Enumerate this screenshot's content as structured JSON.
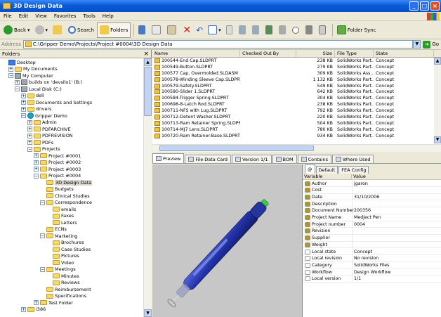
{
  "window": {
    "title": "3D Design Data"
  },
  "menu": [
    "File",
    "Edit",
    "View",
    "Favorites",
    "Tools",
    "Help"
  ],
  "toolbar": {
    "back": "Back",
    "search": "Search",
    "folders": "Folders",
    "folder_sync": "Folder Sync"
  },
  "address": {
    "label": "Address",
    "value": "C:\\Gripper Demo\\Projects\\Project #0004\\3D Design Data",
    "go": "Go"
  },
  "folders_pane": {
    "title": "Folders",
    "close": "×"
  },
  "tree": [
    {
      "label": "Desktop",
      "level": 0,
      "expander": "",
      "icon": "blue"
    },
    {
      "label": "My Documents",
      "level": 1,
      "expander": "+",
      "icon": "folder"
    },
    {
      "label": "My Computer",
      "level": 1,
      "expander": "−",
      "icon": "gray"
    },
    {
      "label": "builds on 'devsilo1' (B:)",
      "level": 2,
      "expander": "+",
      "icon": "gray"
    },
    {
      "label": "Local Disk (C:)",
      "level": 2,
      "expander": "−",
      "icon": "gray"
    },
    {
      "label": "dell",
      "level": 3,
      "expander": "+",
      "icon": "folder"
    },
    {
      "label": "Documents and Settings",
      "level": 3,
      "expander": "+",
      "icon": "folder"
    },
    {
      "label": "drivers",
      "level": 3,
      "expander": "+",
      "icon": "folder"
    },
    {
      "label": "Gripper Demo",
      "level": 3,
      "expander": "−",
      "icon": "vault"
    },
    {
      "label": "Admin",
      "level": 4,
      "expander": "+",
      "icon": "folder"
    },
    {
      "label": "PDFARCHIVE",
      "level": 4,
      "expander": "+",
      "icon": "folder"
    },
    {
      "label": "PDFREVISION",
      "level": 4,
      "expander": "+",
      "icon": "folder"
    },
    {
      "label": "PDFs",
      "level": 4,
      "expander": "+",
      "icon": "folder"
    },
    {
      "label": "Projects",
      "level": 4,
      "expander": "−",
      "icon": "folder"
    },
    {
      "label": "Project #0001",
      "level": 5,
      "expander": "+",
      "icon": "folder"
    },
    {
      "label": "Project #0002",
      "level": 5,
      "expander": "+",
      "icon": "folder"
    },
    {
      "label": "Project #0003",
      "level": 5,
      "expander": "+",
      "icon": "folder"
    },
    {
      "label": "Project #0004",
      "level": 5,
      "expander": "−",
      "icon": "folder"
    },
    {
      "label": "3D Design Data",
      "level": 6,
      "expander": "",
      "icon": "folder",
      "selected": true
    },
    {
      "label": "Budgets",
      "level": 6,
      "expander": "",
      "icon": "folder"
    },
    {
      "label": "Clinical Studies",
      "level": 6,
      "expander": "",
      "icon": "folder"
    },
    {
      "label": "Correspondence",
      "level": 6,
      "expander": "−",
      "icon": "folder"
    },
    {
      "label": "emails",
      "level": 7,
      "expander": "",
      "icon": "folder"
    },
    {
      "label": "Faxes",
      "level": 7,
      "expander": "",
      "icon": "folder"
    },
    {
      "label": "Letters",
      "level": 7,
      "expander": "",
      "icon": "folder"
    },
    {
      "label": "ECNs",
      "level": 6,
      "expander": "",
      "icon": "folder"
    },
    {
      "label": "Marketing",
      "level": 6,
      "expander": "−",
      "icon": "folder"
    },
    {
      "label": "Brochures",
      "level": 7,
      "expander": "",
      "icon": "folder"
    },
    {
      "label": "Case Studies",
      "level": 7,
      "expander": "",
      "icon": "folder"
    },
    {
      "label": "Pictures",
      "level": 7,
      "expander": "",
      "icon": "folder"
    },
    {
      "label": "Video",
      "level": 7,
      "expander": "",
      "icon": "folder"
    },
    {
      "label": "Meetings",
      "level": 6,
      "expander": "−",
      "icon": "folder"
    },
    {
      "label": "Minutes",
      "level": 7,
      "expander": "",
      "icon": "folder"
    },
    {
      "label": "Reviews",
      "level": 7,
      "expander": "",
      "icon": "folder"
    },
    {
      "label": "Reimbursement",
      "level": 6,
      "expander": "",
      "icon": "folder"
    },
    {
      "label": "Specifications",
      "level": 6,
      "expander": "",
      "icon": "folder"
    },
    {
      "label": "Test Folder",
      "level": 5,
      "expander": "+",
      "icon": "folder"
    },
    {
      "label": "i386",
      "level": 3,
      "expander": "+",
      "icon": "folder"
    }
  ],
  "file_list": {
    "headers": [
      "Name",
      "Checked Out By",
      "Size",
      "File Type",
      "State"
    ],
    "rows": [
      [
        "100544-End Cap.SLDPRT",
        "",
        "238 KB",
        "SolidWorks Part...",
        "Concept"
      ],
      [
        "100549-Button.SLDPRT",
        "",
        "279 KB",
        "SolidWorks Part...",
        "Concept"
      ],
      [
        "100577 Cap, Overmolded.SLDASM",
        "",
        "309 KB",
        "SolidWorks Ass...",
        "Concept"
      ],
      [
        "100578-Winding Sleeve Cap.SLDPRT",
        "",
        "1 132 KB",
        "SolidWorks Part...",
        "Concept"
      ],
      [
        "100579-Safety.SLDPRT",
        "",
        "549 KB",
        "SolidWorks Part...",
        "Concept"
      ],
      [
        "100580-Slider 1.SLDPRT",
        "",
        "642 KB",
        "SolidWorks Part...",
        "Concept"
      ],
      [
        "100584-Trigger Spring.SLDPRT",
        "",
        "304 KB",
        "SolidWorks Part...",
        "Concept"
      ],
      [
        "100698-8-Latch Rod.SLDPRT",
        "",
        "238 KB",
        "SolidWorks Part...",
        "Concept"
      ],
      [
        "100711-NFS with Lug.SLDPRT",
        "",
        "792 KB",
        "SolidWorks Part...",
        "Concept"
      ],
      [
        "100712-Detent Washer.SLDPRT",
        "",
        "220 KB",
        "SolidWorks Part...",
        "Concept"
      ],
      [
        "100713-Ram Retainer Spring.SLDPRT",
        "",
        "504 KB",
        "SolidWorks Part...",
        "Concept"
      ],
      [
        "100714-MJ7 Lens.SLDPRT",
        "",
        "780 KB",
        "SolidWorks Part...",
        "Concept"
      ],
      [
        "100720-Ram Retainer-Base.SLDPRT",
        "",
        "934 KB",
        "SolidWorks Part...",
        "Concept"
      ]
    ]
  },
  "tabs": [
    "Preview",
    "File Data Card",
    "Version 1/1",
    "BOM",
    "Contains",
    "Where Used"
  ],
  "properties": {
    "tabs": [
      "@",
      "Default",
      "FEA Config"
    ],
    "headers": [
      "Variable",
      "Value"
    ],
    "rows": [
      [
        "Author",
        "jgaron"
      ],
      [
        "Cost",
        ""
      ],
      [
        "Date",
        "31/10/2006"
      ],
      [
        "Description",
        ""
      ],
      [
        "Document Number",
        "200356"
      ],
      [
        "Project Name",
        "Medject Pen"
      ],
      [
        "Project number",
        "0004"
      ],
      [
        "Revision",
        ""
      ],
      [
        "Supplier",
        ""
      ],
      [
        "Weight",
        ""
      ],
      [
        "Local state",
        "Concept"
      ],
      [
        "Local revision",
        "No revision"
      ],
      [
        "Category",
        "SolidWorks Files"
      ],
      [
        "Workflow",
        "Design Workflow"
      ],
      [
        "Local version",
        "1/1"
      ]
    ]
  },
  "colors": {
    "titlebar": "#0a5bd8",
    "folder": "#f6d86a",
    "preview_bg": "#c7c7c7",
    "pen_body": "#2233aa"
  }
}
